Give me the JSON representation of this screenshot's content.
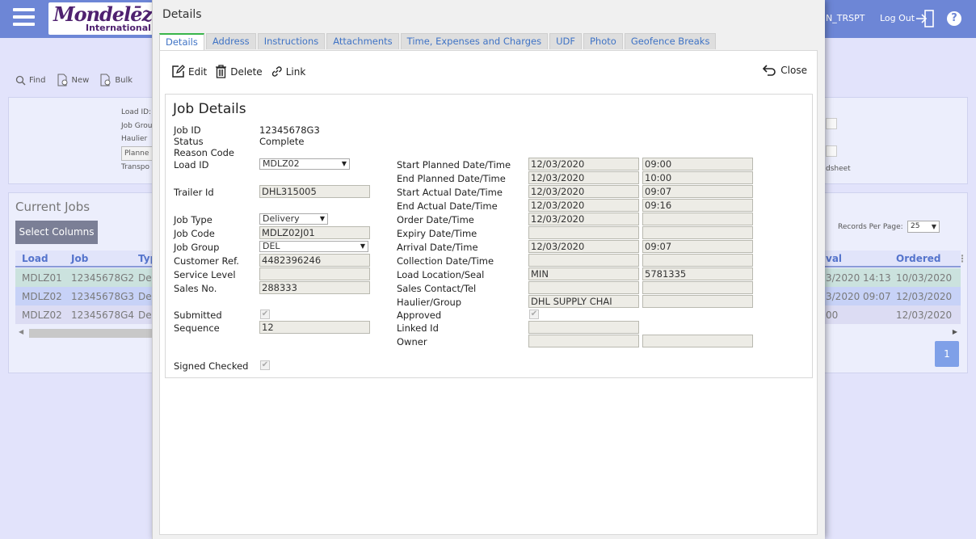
{
  "bg": {
    "logo_line1": "Mondelēz",
    "logo_line2": "International",
    "user": "N_TRSPT",
    "logout": "Log Out",
    "help": "?",
    "tools": {
      "find": "Find",
      "new": "New",
      "bulk": "Bulk"
    },
    "filter_labels": [
      "Load ID:",
      "Job Grou",
      "Haulier",
      "Planne",
      "Transpo"
    ],
    "sheet_label": "dsheet",
    "current_jobs": "Current Jobs",
    "select_columns": "Select Columns",
    "records_per_page_label": "Records Per Page:",
    "records_per_page_value": "25",
    "headers": [
      "Load",
      "Job",
      "Typ",
      "val",
      "Ordered"
    ],
    "rows": [
      {
        "load": "MDLZ01",
        "job": "12345678G2",
        "type": "De",
        "arrival": "3/2020 14:13",
        "ordered": "10/03/2020",
        "color": "#cbe2de"
      },
      {
        "load": "MDLZ02",
        "job": "12345678G3",
        "type": "De",
        "arrival": "3/2020 09:07",
        "ordered": "12/03/2020",
        "color": "#c7d2f7"
      },
      {
        "load": "MDLZ02",
        "job": "12345678G4",
        "type": "De",
        "arrival": "00",
        "ordered": "12/03/2020",
        "color": "#dcdcf3"
      }
    ],
    "page_number": "1"
  },
  "modal": {
    "title": "Details",
    "tabs": [
      "Details",
      "Address",
      "Instructions",
      "Attachments",
      "Time, Expenses and Charges",
      "UDF",
      "Photo",
      "Geofence Breaks"
    ],
    "toolbar": {
      "edit": "Edit",
      "delete": "Delete",
      "link": "Link",
      "close": "Close"
    },
    "section_title": "Job Details",
    "left": {
      "job_id_label": "Job ID",
      "job_id": "12345678G3",
      "status_label": "Status",
      "status": "Complete",
      "reason_code_label": "Reason Code",
      "load_id_label": "Load ID",
      "load_id": "MDLZ02",
      "trailer_id_label": "Trailer Id",
      "trailer_id": "DHL315005",
      "job_type_label": "Job Type",
      "job_type": "Delivery",
      "job_code_label": "Job Code",
      "job_code": "MDLZ02J01",
      "job_group_label": "Job Group",
      "job_group": "DEL",
      "customer_ref_label": "Customer Ref.",
      "customer_ref": "4482396246",
      "service_level_label": "Service Level",
      "service_level": "",
      "sales_no_label": "Sales No.",
      "sales_no": "288333",
      "submitted_label": "Submitted",
      "sequence_label": "Sequence",
      "sequence": "12",
      "signed_checked_label": "Signed Checked"
    },
    "right": {
      "start_planned_label": "Start Planned Date/Time",
      "start_planned_date": "12/03/2020",
      "start_planned_time": "09:00",
      "end_planned_label": "End Planned Date/Time",
      "end_planned_date": "12/03/2020",
      "end_planned_time": "10:00",
      "start_actual_label": "Start Actual Date/Time",
      "start_actual_date": "12/03/2020",
      "start_actual_time": "09:07",
      "end_actual_label": "End Actual Date/Time",
      "end_actual_date": "12/03/2020",
      "end_actual_time": "09:16",
      "order_label": "Order Date/Time",
      "order_date": "12/03/2020",
      "order_time": "",
      "expiry_label": "Expiry Date/Time",
      "expiry_date": "",
      "expiry_time": "",
      "arrival_label": "Arrival Date/Time",
      "arrival_date": "12/03/2020",
      "arrival_time": "09:07",
      "collection_label": "Collection Date/Time",
      "collection_date": "",
      "collection_time": "",
      "load_location_label": "Load Location/Seal",
      "load_location": "MIN",
      "seal": "5781335",
      "sales_contact_label": "Sales Contact/Tel",
      "sales_contact": "",
      "tel": "",
      "haulier_label": "Haulier/Group",
      "haulier": "DHL SUPPLY CHAI",
      "group": "",
      "approved_label": "Approved",
      "linked_id_label": "Linked Id",
      "linked_id": "",
      "owner_label": "Owner",
      "owner": "",
      "owner2": ""
    }
  }
}
